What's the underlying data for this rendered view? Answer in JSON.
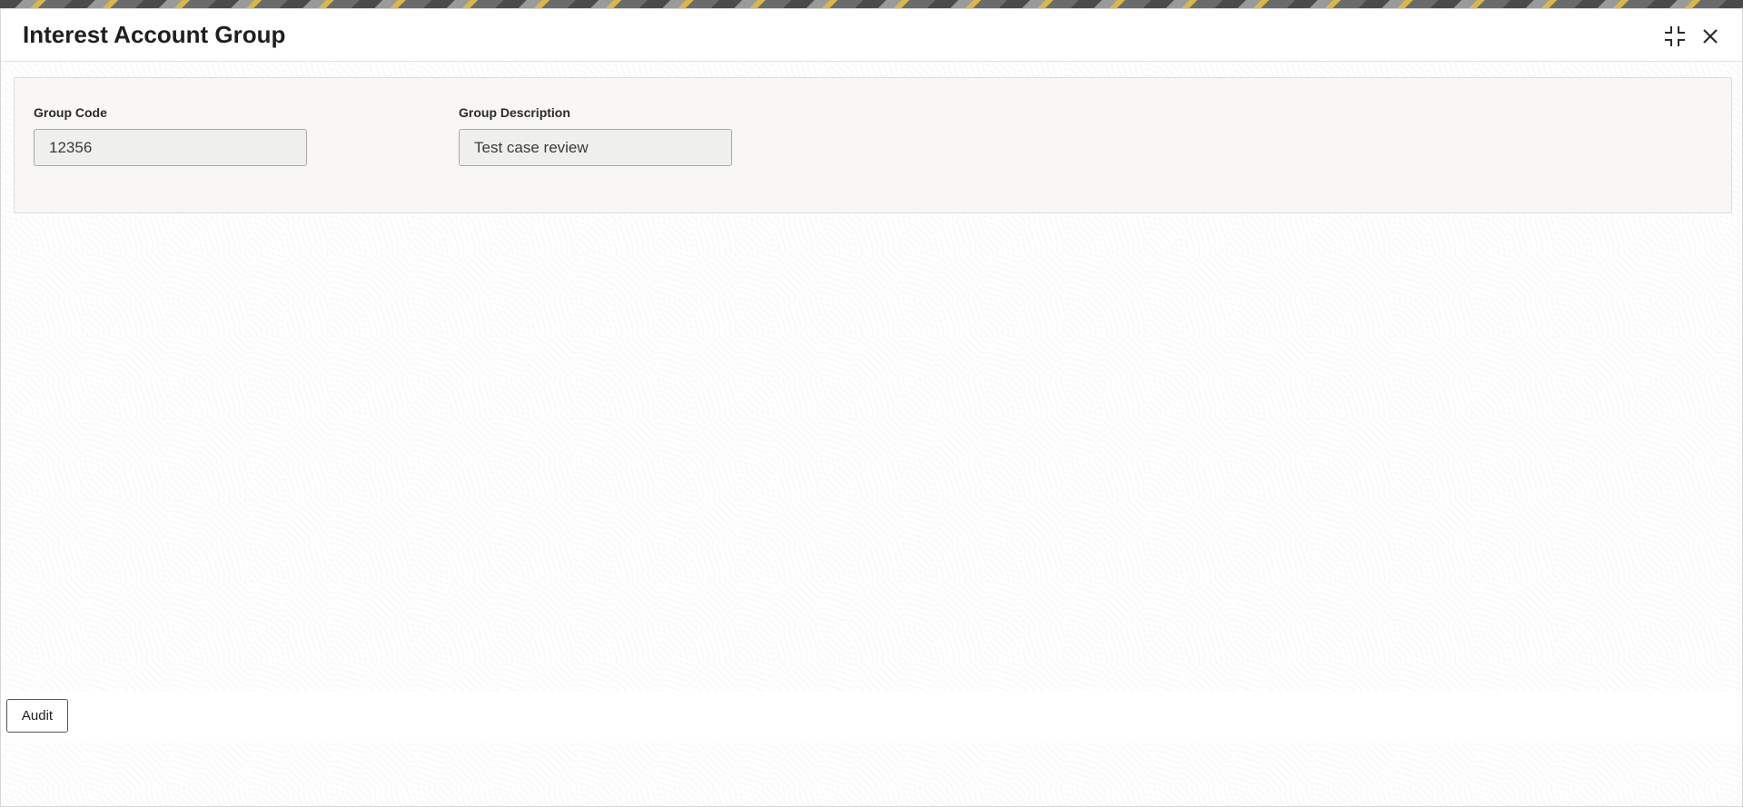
{
  "window": {
    "title": "Interest Account Group"
  },
  "header_actions": {
    "minimize_icon": "compress-icon",
    "close_icon": "close-icon"
  },
  "form": {
    "group_code": {
      "label": "Group Code",
      "value": "12356"
    },
    "group_description": {
      "label": "Group Description",
      "value": "Test case review"
    }
  },
  "footer": {
    "audit_label": "Audit"
  },
  "colors": {
    "panel_background": "#f8f7f5",
    "input_background": "#efefee",
    "title_text": "#1f1f1f"
  }
}
